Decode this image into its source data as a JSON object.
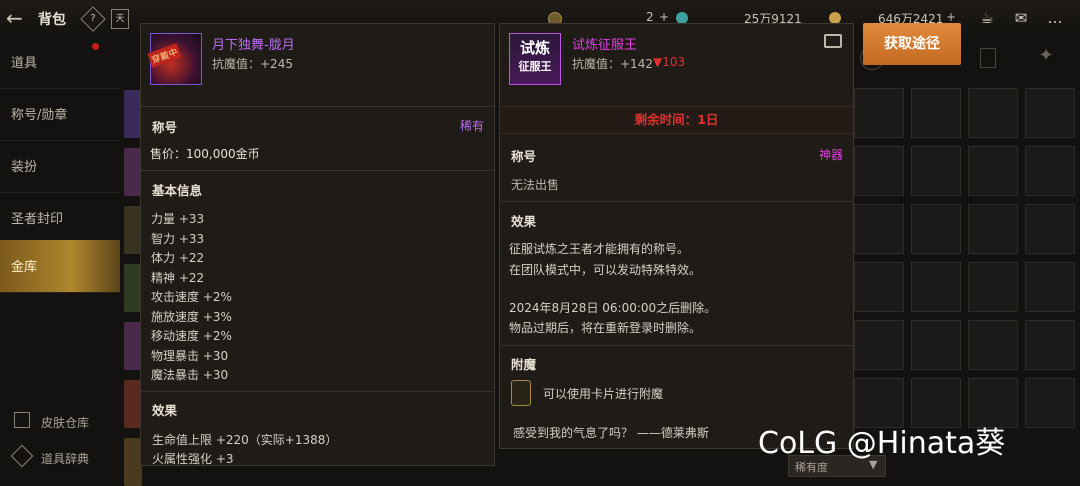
{
  "topbar": {
    "title": "背包",
    "help_icon": "?",
    "book_icon": "天",
    "currency1_value": "2",
    "currency2_value": "25万9121",
    "currency3_value": "646万2421",
    "plus": "+"
  },
  "sidebar": {
    "items": [
      {
        "label": "道具"
      },
      {
        "label": "称号/勋章"
      },
      {
        "label": "装扮"
      },
      {
        "label": "圣者封印"
      },
      {
        "label": "金库"
      }
    ],
    "skin_warehouse": "皮肤仓库",
    "item_dictionary": "道具辞典"
  },
  "tooltip_left": {
    "name": "月下独舞-胧月",
    "equipped_badge": "穿戴中",
    "resist": "抗魔值：+245",
    "type": "称号",
    "rarity": "稀有",
    "price": "售价：100,000金币",
    "basic_info_header": "基本信息",
    "stats": [
      "力量 +33",
      "智力 +33",
      "体力 +22",
      "精神 +22",
      "攻击速度 +2%",
      "施放速度 +3%",
      "移动速度 +2%",
      "物理暴击 +30",
      "魔法暴击 +30"
    ],
    "effect_header": "效果",
    "effects": [
      "生命值上限 +220（实际+1388）",
      "火属性强化 +3"
    ]
  },
  "tooltip_right": {
    "name": "试炼征服王",
    "icon_text_top": "试炼",
    "icon_text_bottom": "征服王",
    "resist": "抗魔值：+142",
    "resist_diff": "▼103",
    "remaining": "剩余时间：1日",
    "type": "称号",
    "rarity": "神器",
    "sale": "无法出售",
    "effect_header": "效果",
    "desc1": "征服试炼之王者才能拥有的称号。",
    "desc2": "在团队模式中，可以发动特殊特效。",
    "desc3": "2024年8月28日 06:00:00之后删除。",
    "desc4": "物品过期后，将在重新登录时删除。",
    "enchant_header": "附魔",
    "enchant_text": "可以使用卡片进行附魔",
    "quote": "感受到我的气息了吗？ ——德莱弗斯"
  },
  "get_route_button": "获取途径",
  "sort_label": "稀有度",
  "watermark": "CoLG @Hinata葵",
  "colors": {
    "rare": "#b86cf0",
    "artifact": "#e040e0",
    "red": "#e03030",
    "accent": "#d27a2e"
  }
}
